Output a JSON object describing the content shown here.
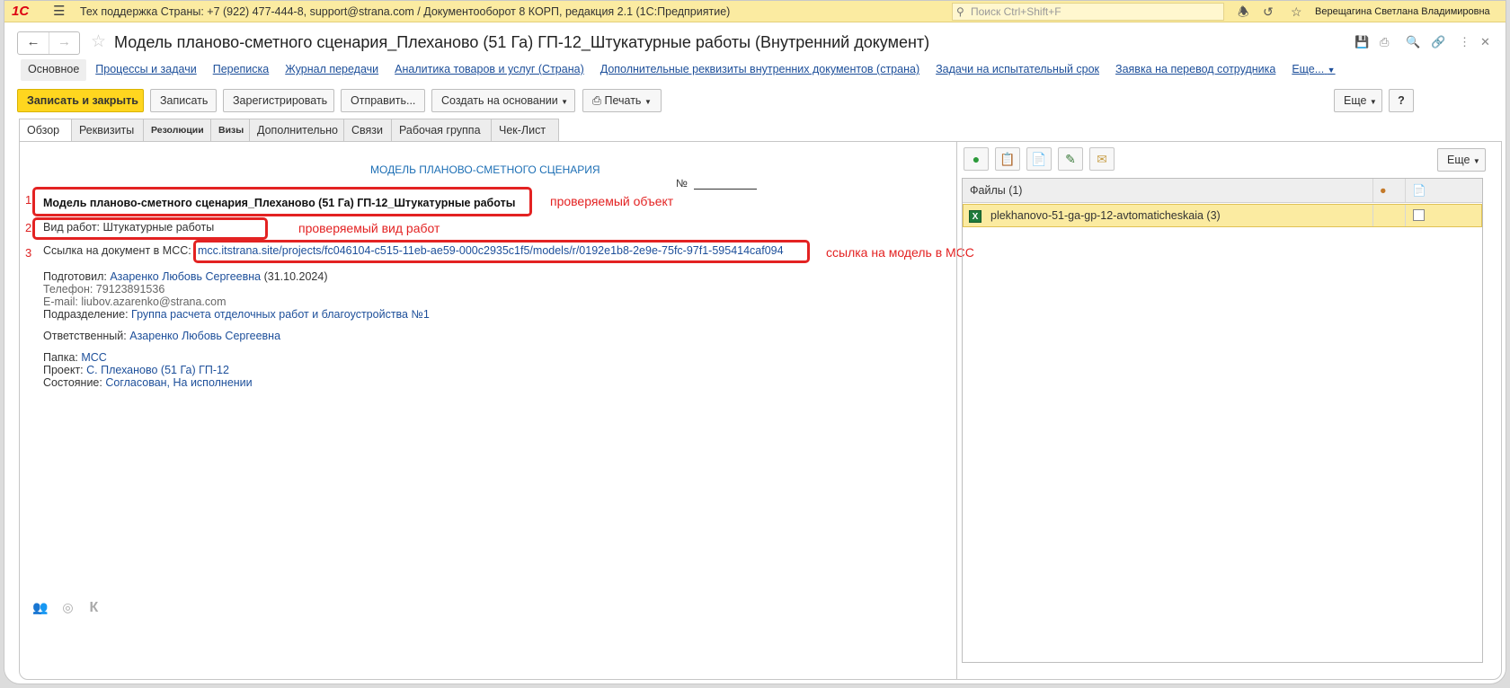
{
  "topbar": {
    "logo": "1С",
    "app_title": "Тех поддержка Страны: +7 (922) 477-444-8, support@strana.com / Документооборот 8 КОРП, редакция 2.1  (1С:Предприятие)",
    "search_placeholder": "Поиск Ctrl+Shift+F",
    "user": "Верещагина Светлана Владимировна"
  },
  "header": {
    "title": "Модель планово-сметного сценария_Плеханово (51 Га) ГП-12_Штукатурные работы (Внутренний документ)"
  },
  "menu": {
    "items": [
      "Основное",
      "Процессы и задачи",
      "Переписка",
      "Журнал передачи",
      "Аналитика товаров и услуг (Страна)",
      "Дополнительные реквизиты внутренних документов (страна)",
      "Задачи на испытательный срок",
      "Заявка на перевод сотрудника",
      "Еще..."
    ]
  },
  "toolbar": {
    "save_close": "Записать и закрыть",
    "save": "Записать",
    "register": "Зарегистрировать",
    "send": "Отправить...",
    "create_based": "Создать на основании",
    "print": "Печать",
    "more": "Еще",
    "help": "?"
  },
  "tabs": [
    "Обзор",
    "Реквизиты",
    "Резолюции",
    "Визы",
    "Дополнительно",
    "Связи",
    "Рабочая группа",
    "Чек-Лист"
  ],
  "overview": {
    "heading": "МОДЕЛЬ ПЛАНОВО-СМЕТНОГО СЦЕНАРИЯ",
    "number_label": "№",
    "object_name": "Модель планово-сметного сценария_Плеханово (51 Га) ГП-12_Штукатурные работы",
    "work_type_label": "Вид работ: Штукатурные работы",
    "link_label": "Ссылка на документ в МСС:",
    "link_value": "mcc.itstrana.site/projects/fc046104-c515-11eb-ae59-000c2935c1f5/models/r/0192e1b8-2e9e-75fc-97f1-595414caf094",
    "prepared_label": "Подготовил:",
    "prepared_name": "Азаренко Любовь Сергеевна",
    "prepared_date": "(31.10.2024)",
    "phone": "Телефон: 79123891536",
    "email": "E-mail: liubov.azarenko@strana.com",
    "department_label": "Подразделение:",
    "department": "Группа расчета отделочных работ и благоустройства №1",
    "responsible_label": "Ответственный:",
    "responsible": "Азаренко Любовь Сергеевна",
    "folder_label": "Папка:",
    "folder": "МСС",
    "project_label": "Проект:",
    "project": "С. Плеханово (51 Га) ГП-12",
    "state_label": "Состояние:",
    "state": "Согласован, На исполнении"
  },
  "annotations": {
    "n1": "1",
    "n2": "2",
    "n3": "3",
    "a1": "проверяемый объект",
    "a2": "проверяемый вид работ",
    "a3": "ссылка на модель в МСС",
    "color": "#e32222"
  },
  "files": {
    "more": "Еще",
    "header": "Файлы (1)",
    "rows": [
      {
        "name": "plekhanovo-51-ga-gp-12-avtomaticheskaia (3)"
      }
    ]
  },
  "bottom": {
    "k": "К"
  }
}
